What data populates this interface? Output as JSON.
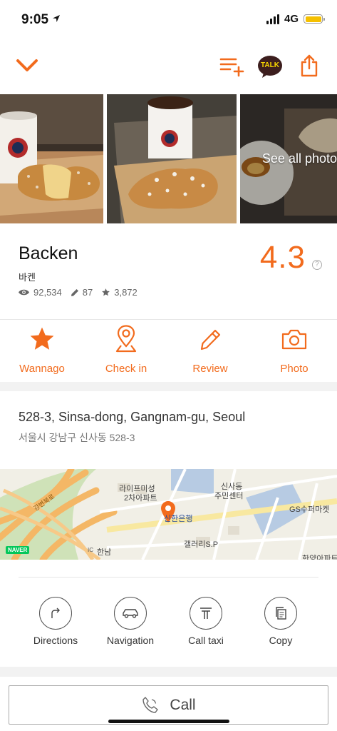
{
  "status": {
    "time": "9:05",
    "network": "4G"
  },
  "colors": {
    "accent": "#f26b1d",
    "battery": "#f5c000",
    "kakao": "#3c1e1e"
  },
  "toolbar": {
    "collapse_icon": "chevron-down-icon",
    "add_list_icon": "playlist-add-icon",
    "kakao_badge": "TALK",
    "share_icon": "share-icon"
  },
  "photos": {
    "see_all_label": "See all photo"
  },
  "place": {
    "name": "Backen",
    "local_name": "바켄",
    "views": "92,534",
    "reviews": "87",
    "wannagos": "3,872",
    "rating": "4.3"
  },
  "actions": [
    {
      "label": "Wannago",
      "icon": "star-icon"
    },
    {
      "label": "Check in",
      "icon": "location-pin-icon"
    },
    {
      "label": "Review",
      "icon": "pencil-icon"
    },
    {
      "label": "Photo",
      "icon": "camera-icon"
    }
  ],
  "address": {
    "main": "528-3, Sinsa-dong, Gangnam-gu, Seoul",
    "local": "서울시 강남구 신사동 528-3"
  },
  "map": {
    "labels": {
      "building1": "라이프미성",
      "building1b": "2차아파트",
      "bank": "신한은행",
      "center1": "신사동",
      "center2": "주민센터",
      "gallery": "갤러리S.P",
      "market": "GS수퍼마켓",
      "hannam": "한남",
      "ic": "IC",
      "road": "강변북로",
      "partial": "한양아파트",
      "naver": "NAVER"
    }
  },
  "nav": [
    {
      "label": "Directions",
      "icon": "turn-right-icon"
    },
    {
      "label": "Navigation",
      "icon": "car-icon"
    },
    {
      "label": "Call taxi",
      "icon": "taxi-icon"
    },
    {
      "label": "Copy",
      "icon": "copy-icon"
    }
  ],
  "call": {
    "label": "Call"
  }
}
